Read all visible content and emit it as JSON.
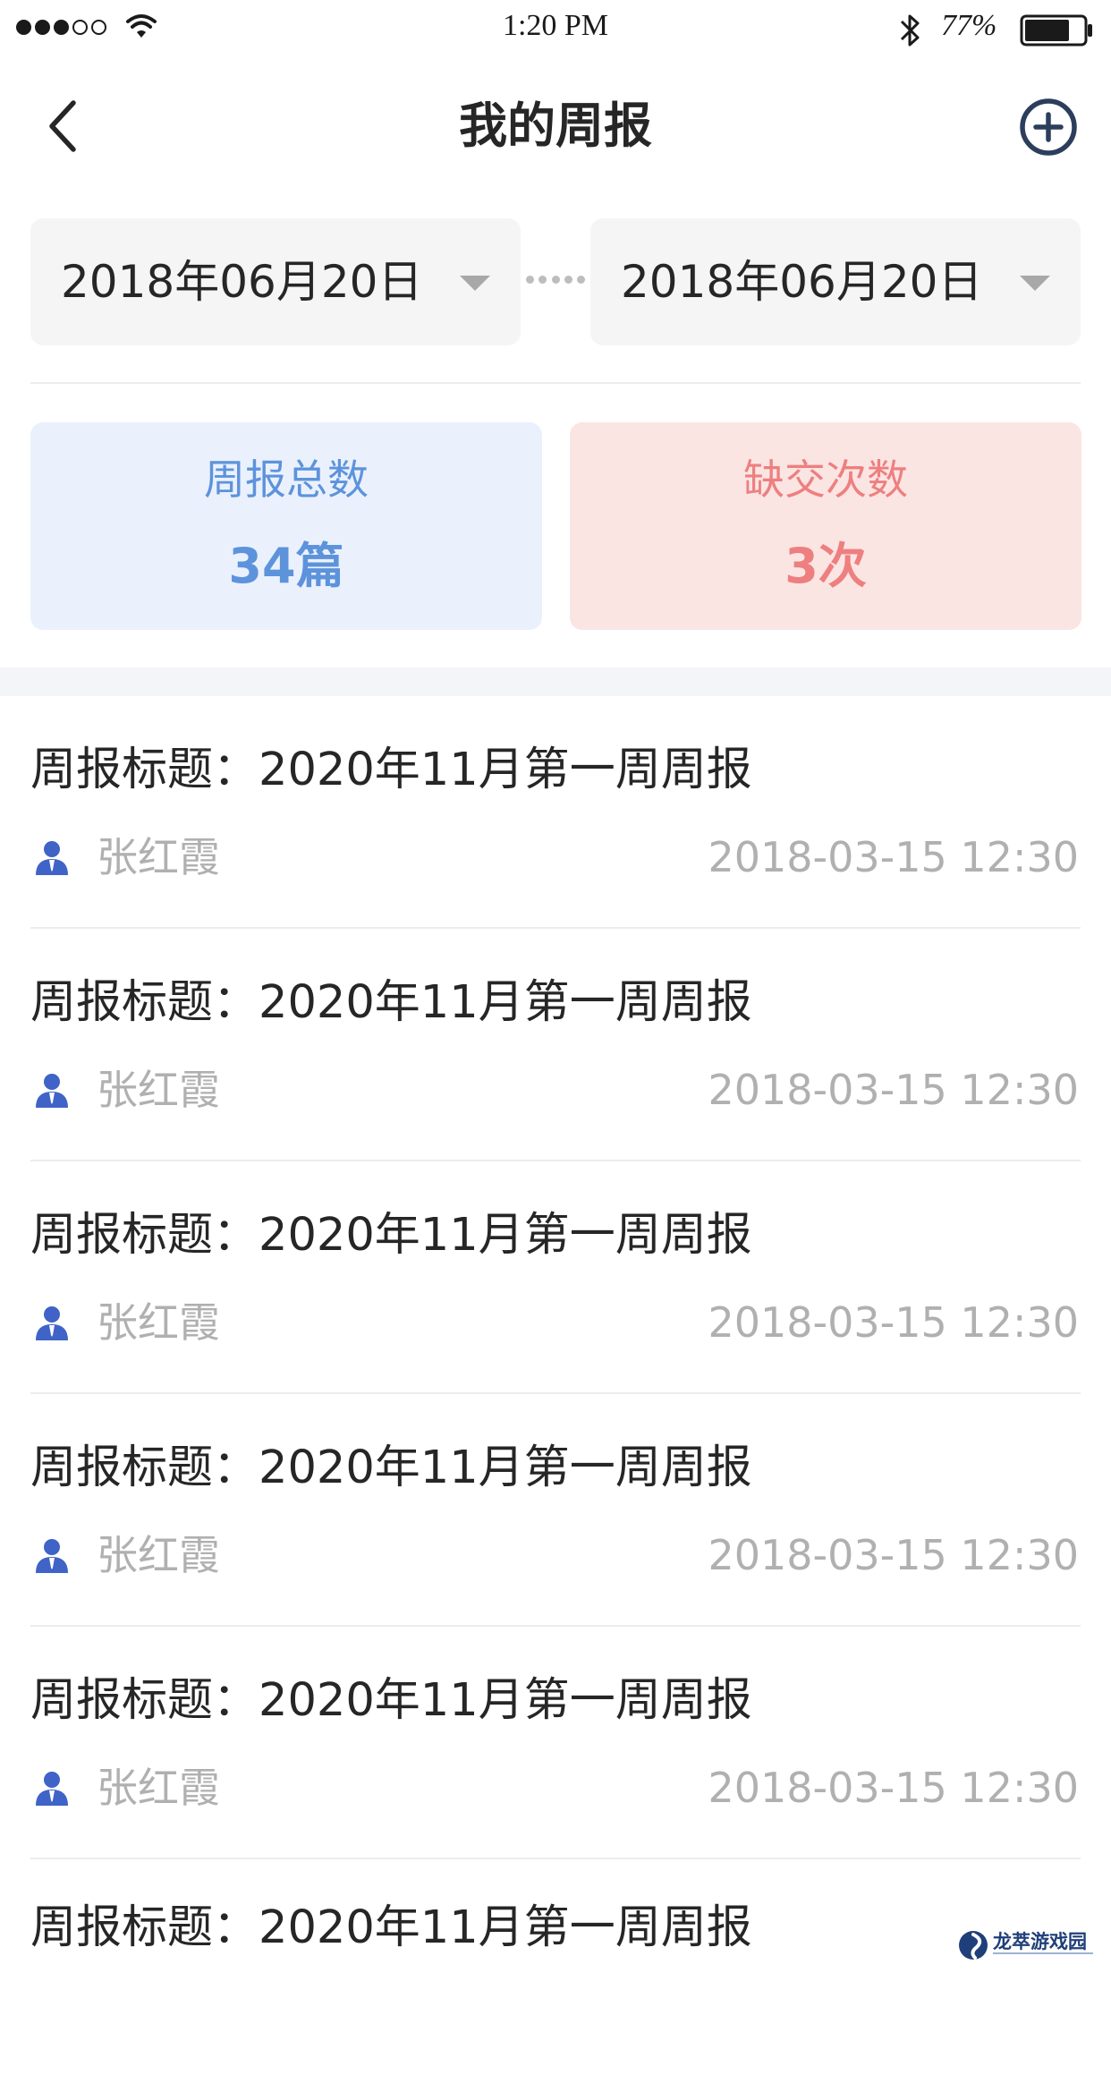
{
  "status_bar": {
    "time": "1:20 PM",
    "battery": "77%",
    "signal_bars_filled": 3,
    "signal_bars_total": 5,
    "battery_level": 0.77
  },
  "nav": {
    "title": "我的周报",
    "back_icon": "chevron-left-icon",
    "add_icon": "plus-circle-icon"
  },
  "date_range": {
    "start": "2018年06月20日",
    "end": "2018年06月20日"
  },
  "stats": {
    "total_label": "周报总数",
    "total_value": "34篇",
    "missed_label": "缺交次数",
    "missed_value": "3次"
  },
  "colors": {
    "total_accent": "#5d93db",
    "missed_accent": "#ee7f80",
    "author_icon": "#3f63c7"
  },
  "reports": [
    {
      "title": "周报标题：2020年11月第一周周报",
      "author": "张红霞",
      "time": "2018-03-15 12:30"
    },
    {
      "title": "周报标题：2020年11月第一周周报",
      "author": "张红霞",
      "time": "2018-03-15 12:30"
    },
    {
      "title": "周报标题：2020年11月第一周周报",
      "author": "张红霞",
      "time": "2018-03-15 12:30"
    },
    {
      "title": "周报标题：2020年11月第一周周报",
      "author": "张红霞",
      "time": "2018-03-15 12:30"
    },
    {
      "title": "周报标题：2020年11月第一周周报",
      "author": "张红霞",
      "time": "2018-03-15 12:30"
    },
    {
      "title": "周报标题：2020年11月第一周周报",
      "author": "",
      "time": ""
    }
  ],
  "watermark": {
    "text": "龙萃游戏园"
  }
}
